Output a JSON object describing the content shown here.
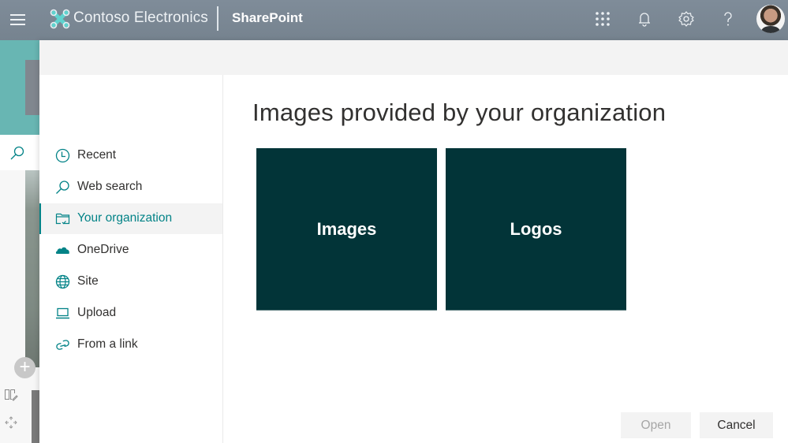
{
  "topbar": {
    "menu_icon": "hamburger-icon",
    "brand": "Contoso Electronics",
    "app_name": "SharePoint",
    "icons": [
      "app-launcher-icon",
      "bell-icon",
      "gear-icon",
      "help-icon"
    ],
    "avatar": "user-avatar"
  },
  "panel": {
    "nav": {
      "items": [
        {
          "label": "Recent",
          "icon": "clock-icon",
          "selected": false
        },
        {
          "label": "Web search",
          "icon": "search-icon",
          "selected": false
        },
        {
          "label": "Your organization",
          "icon": "folder-check-icon",
          "selected": true
        },
        {
          "label": "OneDrive",
          "icon": "cloud-icon",
          "selected": false
        },
        {
          "label": "Site",
          "icon": "globe-icon",
          "selected": false
        },
        {
          "label": "Upload",
          "icon": "laptop-icon",
          "selected": false
        },
        {
          "label": "From a link",
          "icon": "link-icon",
          "selected": false
        }
      ]
    },
    "content": {
      "title": "Images provided by your organization",
      "tiles": [
        {
          "label": "Images"
        },
        {
          "label": "Logos"
        }
      ]
    },
    "footer": {
      "open_label": "Open",
      "open_disabled": true,
      "cancel_label": "Cancel"
    }
  },
  "colors": {
    "accent": "#038387",
    "tile_bg": "#023438",
    "topbar_bg": "#7a8794"
  }
}
